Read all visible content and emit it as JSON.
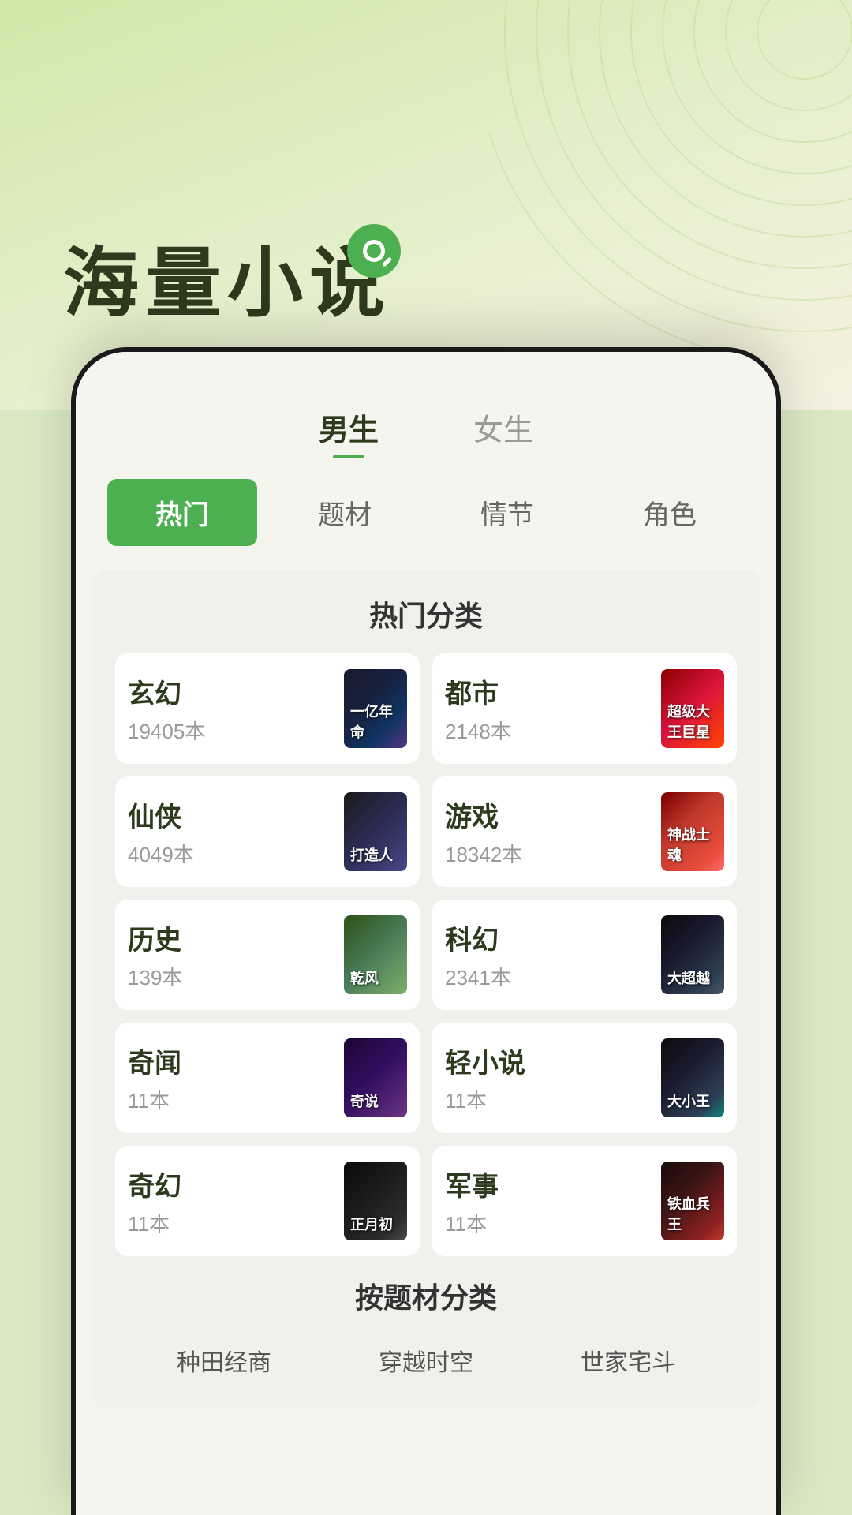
{
  "app": {
    "title": "海量小说",
    "search_icon": "search-icon"
  },
  "tabs": {
    "male": "男生",
    "female": "女生",
    "active": "male"
  },
  "filter_tabs": [
    {
      "id": "hot",
      "label": "热门",
      "active": true
    },
    {
      "id": "theme",
      "label": "题材",
      "active": false
    },
    {
      "id": "plot",
      "label": "情节",
      "active": false
    },
    {
      "id": "role",
      "label": "角色",
      "active": false
    }
  ],
  "hot_section": {
    "title": "热门分类"
  },
  "categories": [
    {
      "id": "xuanhuan",
      "name": "玄幻",
      "count": "19405本",
      "cover_class": "cover-xuanhuan",
      "cover_text": "一亿年命"
    },
    {
      "id": "dushi",
      "name": "都市",
      "count": "2148本",
      "cover_class": "cover-dushi",
      "cover_text": "超级大王巨星"
    },
    {
      "id": "xianxia",
      "name": "仙侠",
      "count": "4049本",
      "cover_class": "cover-xianxia",
      "cover_text": "打造人"
    },
    {
      "id": "youxi",
      "name": "游戏",
      "count": "18342本",
      "cover_class": "cover-youxi",
      "cover_text": "神战士魂"
    },
    {
      "id": "lishi",
      "name": "历史",
      "count": "139本",
      "cover_class": "cover-lishi",
      "cover_text": "乾风"
    },
    {
      "id": "kehuan",
      "name": "科幻",
      "count": "2341本",
      "cover_class": "cover-kehuan",
      "cover_text": "大超越"
    },
    {
      "id": "qiwen",
      "name": "奇闻",
      "count": "11本",
      "cover_class": "cover-qiwen",
      "cover_text": "奇说"
    },
    {
      "id": "qingxiaoshuo",
      "name": "轻小说",
      "count": "11本",
      "cover_class": "cover-qingxiaoshuo",
      "cover_text": "大小王"
    },
    {
      "id": "qihuan",
      "name": "奇幻",
      "count": "11本",
      "cover_class": "cover-qihuan",
      "cover_text": "正月初"
    },
    {
      "id": "junshi",
      "name": "军事",
      "count": "11本",
      "cover_class": "cover-junshi",
      "cover_text": "铁血兵王"
    }
  ],
  "theme_section": {
    "title": "按题材分类"
  },
  "theme_tags": [
    {
      "id": "nongye",
      "label": "种田经商"
    },
    {
      "id": "chuanyue",
      "label": "穿越时空"
    },
    {
      "id": "shijia",
      "label": "世家宅斗"
    }
  ]
}
